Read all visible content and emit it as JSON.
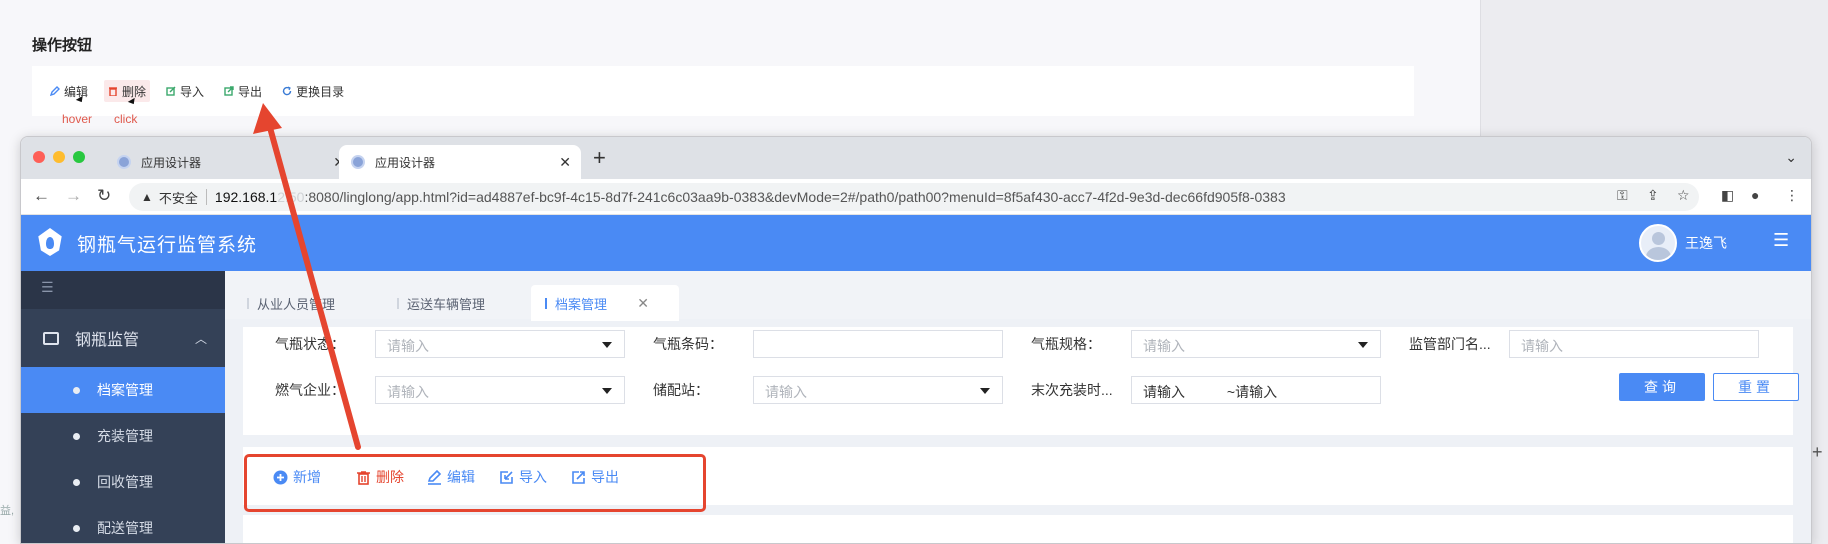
{
  "doc": {
    "title": "操作按钮",
    "demo_buttons": [
      {
        "label": "编辑",
        "icon": "edit-icon"
      },
      {
        "label": "删除",
        "icon": "delete-icon"
      },
      {
        "label": "导入",
        "icon": "import-icon"
      },
      {
        "label": "导出",
        "icon": "export-icon"
      },
      {
        "label": "更换目录",
        "icon": "refresh-icon"
      }
    ],
    "hover_caption": "hover",
    "click_caption": "click",
    "side_text": "益,"
  },
  "browser": {
    "tabs": [
      {
        "title": "应用设计器",
        "active": false
      },
      {
        "title": "应用设计器",
        "active": true
      }
    ],
    "security_label": "不安全",
    "url_host": "192.168.1",
    "url_host_hidden": "2.50",
    "url_rest": ":8080/linglong/app.html?id=ad4887ef-bc9f-4c15-8d7f-241c6c03aa9b-0383&devMode=2#/path0/path00?menuId=8f5af430-acc7-4f2d-9e3d-dec66fd905f8-0383"
  },
  "app": {
    "title": "钢瓶气运行监管系统",
    "user_name": "王逸飞",
    "sidebar": {
      "group_label": "钢瓶监管",
      "items": [
        {
          "label": "档案管理",
          "active": true
        },
        {
          "label": "充装管理",
          "active": false
        },
        {
          "label": "回收管理",
          "active": false
        },
        {
          "label": "配送管理",
          "active": false
        }
      ]
    },
    "page_tabs": [
      {
        "label": "从业人员管理"
      },
      {
        "label": "运送车辆管理"
      },
      {
        "label": "档案管理"
      }
    ],
    "filters": {
      "status_label": "气瓶状态：",
      "barcode_label": "气瓶条码：",
      "spec_label": "气瓶规格：",
      "dept_label": "监管部门名...",
      "company_label": "燃气企业：",
      "station_label": "储配站：",
      "last_fill_label": "末次充装时...",
      "placeholder": "请输入",
      "range_sep": "~",
      "query_label": "查询",
      "reset_label": "重置"
    },
    "toolbar": [
      {
        "label": "新增",
        "color": "#4a8af4",
        "icon": "plus-circle-icon"
      },
      {
        "label": "删除",
        "color": "#e5452f",
        "icon": "trash-icon"
      },
      {
        "label": "编辑",
        "color": "#4a8af4",
        "icon": "edit-icon"
      },
      {
        "label": "导入",
        "color": "#4a8af4",
        "icon": "import-icon"
      },
      {
        "label": "导出",
        "color": "#4a8af4",
        "icon": "export-icon"
      }
    ]
  },
  "colors": {
    "primary": "#4a8af4",
    "danger": "#e5452f",
    "sidebar": "#344157"
  }
}
